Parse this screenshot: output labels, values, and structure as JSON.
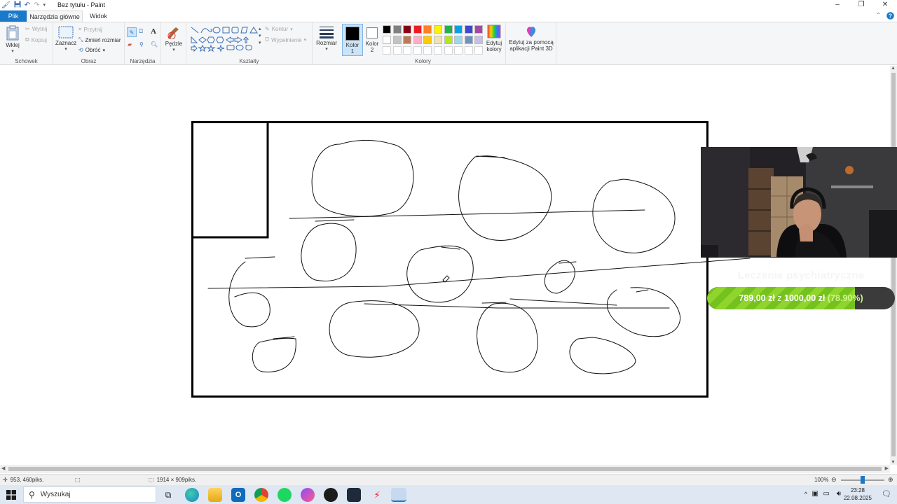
{
  "window": {
    "title": "Bez tytułu - Paint",
    "controls": {
      "minimize": "–",
      "maximize": "❐",
      "close": "✕"
    }
  },
  "tabs": {
    "file": "Plik",
    "home": "Narzędzia główne",
    "view": "Widok"
  },
  "ribbon": {
    "clipboard": {
      "label": "Schowek",
      "paste": "Wklej",
      "cut": "Wytnij",
      "copy": "Kopiuj"
    },
    "image": {
      "label": "Obraz",
      "select": "Zaznacz",
      "crop": "Przytnij",
      "resize": "Zmień rozmiar",
      "rotate": "Obróć"
    },
    "tools": {
      "label": "Narzędzia"
    },
    "brushes": {
      "label": "Pędzle"
    },
    "shapes": {
      "label": "Kształty",
      "outline": "Kontur",
      "fill": "Wypełnienie"
    },
    "size": {
      "label": "Rozmiar"
    },
    "colors": {
      "label": "Kolory",
      "color1": "Kolor 1",
      "color2": "Kolor 2",
      "color1_value": "#000000",
      "color2_value": "#ffffff",
      "edit_colors": "Edytuj kolory",
      "palette_row1": [
        "#000000",
        "#7f7f7f",
        "#880015",
        "#ed1c24",
        "#ff7f27",
        "#fff200",
        "#22b14c",
        "#00a2e8",
        "#3f48cc",
        "#a349a4"
      ],
      "palette_row2": [
        "#ffffff",
        "#c3c3c3",
        "#b97a57",
        "#ffaec9",
        "#ffc90e",
        "#efe4b0",
        "#b5e61d",
        "#99d9ea",
        "#7092be",
        "#c8bfe7"
      ]
    },
    "paint3d": {
      "label": "Edytuj za pomocą aplikacji Paint 3D"
    }
  },
  "status": {
    "cursor_pos": "953, 460piks.",
    "image_size": "1914 × 909piks.",
    "zoom": "100%",
    "zoom_level": 1.0
  },
  "taskbar": {
    "search_placeholder": "Wyszukaj",
    "time": "23:28",
    "date": "22.08.2025",
    "apps": [
      "task-view",
      "edge",
      "file-explorer",
      "outlook",
      "chrome",
      "spotify",
      "messenger",
      "media-app",
      "game-launcher",
      "flash-app",
      "paint"
    ]
  },
  "overlay": {
    "goal_title": "Leczenie psychiatryczne",
    "raised": "789,00 zł",
    "of": "z",
    "goal": "1000,00 zł",
    "percent_label": "(78.90%)",
    "progress": 0.789
  }
}
